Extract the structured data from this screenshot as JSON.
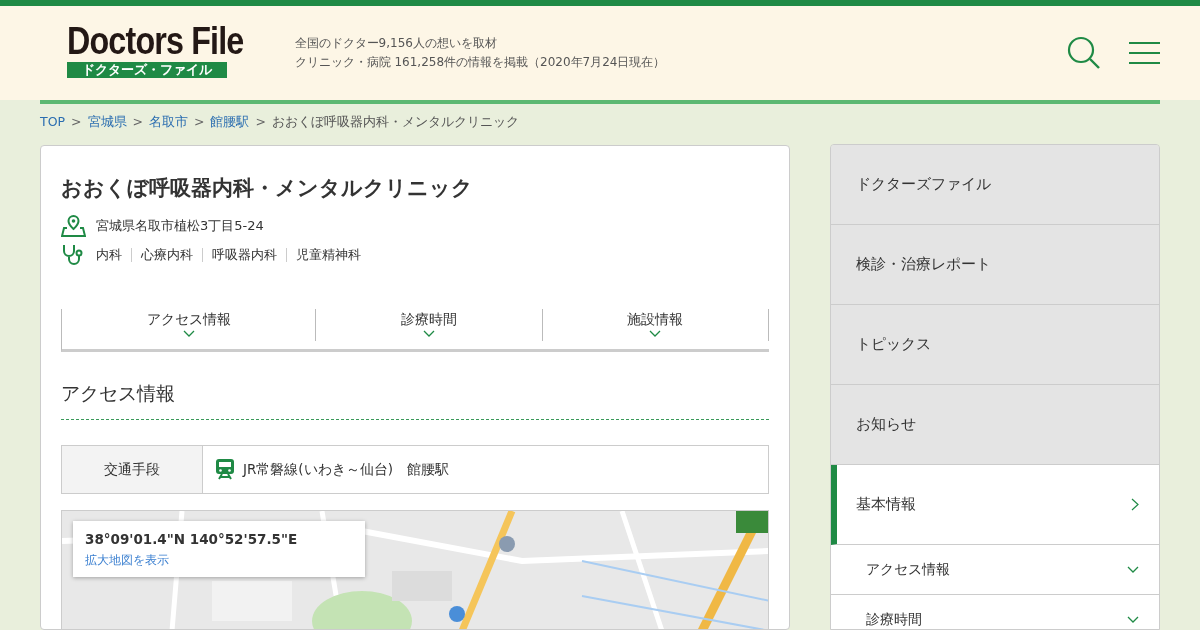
{
  "header": {
    "logo": "Doctors File",
    "logo_sub": "ドクターズ・ファイル",
    "tagline_1": "全国のドクター9,156人の想いを取材",
    "tagline_2": "クリニック・病院 161,258件の情報を掲載（2020年7月24日現在）"
  },
  "breadcrumb": [
    {
      "label": "TOP",
      "kind": "link"
    },
    {
      "label": ">",
      "kind": "separator"
    },
    {
      "label": "宮城県",
      "kind": "link"
    },
    {
      "label": ">",
      "kind": "separator"
    },
    {
      "label": "名取市",
      "kind": "link"
    },
    {
      "label": ">",
      "kind": "separator"
    },
    {
      "label": "館腰駅",
      "kind": "link"
    },
    {
      "label": ">",
      "kind": "separator"
    },
    {
      "label": "おおくぼ呼吸器内科・メンタルクリニック",
      "kind": "current"
    }
  ],
  "clinic": {
    "name": "おおくぼ呼吸器内科・メンタルクリニック",
    "address": "宮城県名取市植松3丁目5-24",
    "departments": [
      "内科",
      "心療内科",
      "呼吸器内科",
      "児童精神科"
    ]
  },
  "tabs": [
    {
      "label": "アクセス情報"
    },
    {
      "label": "診療時間"
    },
    {
      "label": "施設情報"
    }
  ],
  "section_title": "アクセス情報",
  "access": {
    "label": "交通手段",
    "value": "JR常磐線(いわき～仙台)　館腰駅"
  },
  "map": {
    "coords": "38°09'01.4\"N 140°52'57.5\"E",
    "link": "拡大地図を表示"
  },
  "sidebar": [
    {
      "label": "ドクターズファイル",
      "selected": false,
      "kind": "main"
    },
    {
      "label": "検診・治療レポート",
      "selected": false,
      "kind": "main"
    },
    {
      "label": "トピックス",
      "selected": false,
      "kind": "main"
    },
    {
      "label": "お知らせ",
      "selected": false,
      "kind": "main"
    },
    {
      "label": "基本情報",
      "selected": true,
      "kind": "main"
    },
    {
      "label": "アクセス情報",
      "selected": false,
      "kind": "sub"
    },
    {
      "label": "診療時間",
      "selected": false,
      "kind": "sub"
    }
  ]
}
